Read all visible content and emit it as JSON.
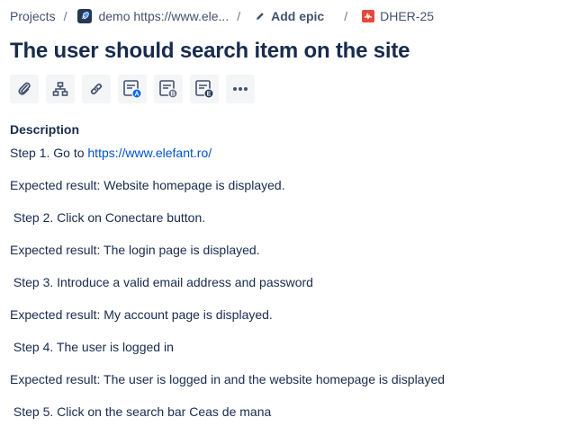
{
  "breadcrumb": {
    "projects": "Projects",
    "project": "demo https://www.ele...",
    "add_epic": "Add epic",
    "issue_key": "DHER-25"
  },
  "issue": {
    "title": "The user should search item on the site"
  },
  "toolbar": {
    "buttons": [
      "attachment-icon",
      "child-issue-icon",
      "link-icon",
      "app-a-icon",
      "app-b-icon",
      "app-e-icon",
      "more-icon"
    ],
    "app_badges": [
      "A",
      "B",
      "E"
    ],
    "more": "•••"
  },
  "description": {
    "label": "Description",
    "step1_prefix": "Step 1. Go to ",
    "step1_link": "https://www.elefant.ro/",
    "lines": [
      "Expected result: Website homepage is displayed.",
      " Step 2. Click on Conectare button.",
      "Expected result: The login page is displayed.",
      " Step 3. Introduce a valid email address and password",
      "Expected result: My account page is displayed.",
      " Step 4. The user is logged in",
      "Expected result: The user is logged in and the website homepage is displayed",
      " Step 5. Click on the search bar Ceas de mana"
    ]
  },
  "colors": {
    "text": "#172b4d",
    "subtle": "#42526e",
    "link": "#0052cc",
    "bug": "#e5493a",
    "badge_a": "#0065ff",
    "badge_b": "#6b778c",
    "badge_e": "#253858"
  }
}
